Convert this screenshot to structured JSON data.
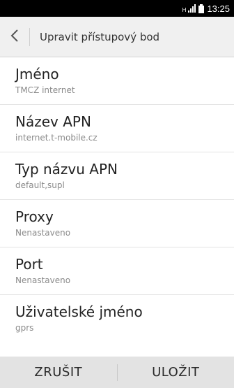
{
  "status_bar": {
    "network_type": "H",
    "time": "13:25"
  },
  "header": {
    "title": "Upravit přístupový bod",
    "back_icon": "chevron-left-icon"
  },
  "fields": [
    {
      "label": "Jméno",
      "value": "TMCZ internet"
    },
    {
      "label": "Název APN",
      "value": "internet.t-mobile.cz"
    },
    {
      "label": "Typ názvu APN",
      "value": "default,supl"
    },
    {
      "label": "Proxy",
      "value": "Nenastaveno"
    },
    {
      "label": "Port",
      "value": "Nenastaveno"
    },
    {
      "label": "Uživatelské jméno",
      "value": "gprs"
    }
  ],
  "actions": {
    "cancel_label": "ZRUŠIT",
    "save_label": "ULOŽIT"
  }
}
